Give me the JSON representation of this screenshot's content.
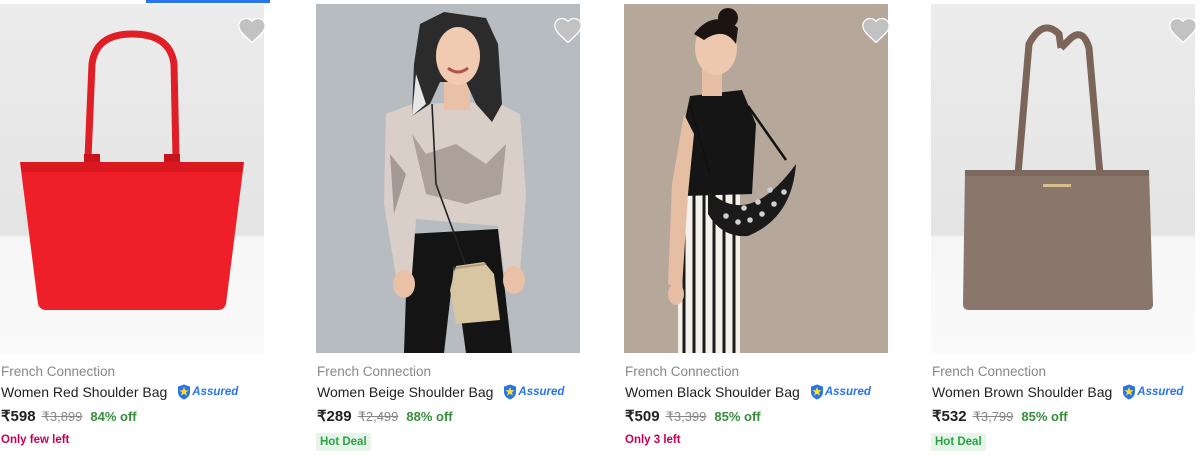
{
  "products": [
    {
      "brand": "French Connection",
      "title": "Women Beige Shoulder Bag",
      "assured_label": "Assured",
      "price": "₹289",
      "mrp": "₹2,499",
      "discount": "88% off",
      "tag": "Hot Deal",
      "image": "woman in sheer floral top carrying beige drawstring crossbody bag",
      "wishlist_icon": "heart-icon"
    },
    {
      "brand": "French Connection",
      "title": "Women Black Shoulder Bag",
      "assured_label": "Assured",
      "price": "₹509",
      "mrp": "₹3,399",
      "discount": "85% off",
      "tag": "Only 3 left",
      "image": "woman in black top and striped trousers with black studded half-moon bag",
      "wishlist_icon": "heart-icon"
    },
    {
      "brand": "French Connection",
      "title": "Women Brown Shoulder Bag",
      "assured_label": "Assured",
      "price": "₹532",
      "mrp": "₹3,799",
      "discount": "85% off",
      "tag": "Hot Deal",
      "image": "brown structured tote bag on light grey background",
      "wishlist_icon": "heart-icon"
    },
    {
      "brand": "French Connection",
      "title": "Women Red Shoulder Bag",
      "assured_label": "Assured",
      "price": "₹598",
      "mrp": "₹3,899",
      "discount": "84% off",
      "tag": "Only few left",
      "image": "red leather tote bag on light grey background",
      "wishlist_icon": "heart-icon"
    }
  ],
  "colors": {
    "accent": "#2874f0",
    "discount": "#388e3c",
    "hot_deal_bg": "#e6f4ea",
    "hot_deal_text": "#26a541",
    "low_stock_text": "#c70055",
    "muted_text": "#878787"
  }
}
